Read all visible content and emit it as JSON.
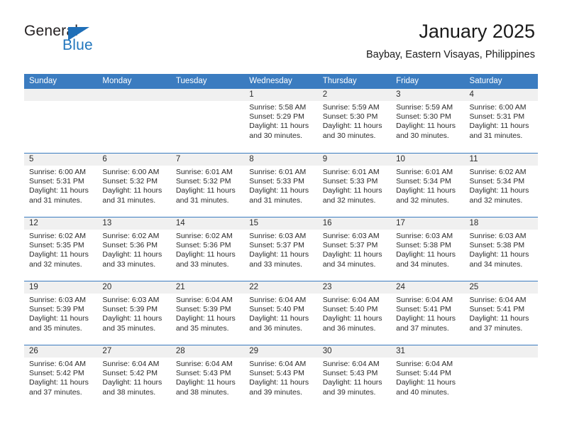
{
  "brand": {
    "word_general": "General",
    "word_blue": "Blue",
    "logo_icon": "triangle-icon"
  },
  "header": {
    "title": "January 2025",
    "subtitle": "Baybay, Eastern Visayas, Philippines"
  },
  "colors": {
    "header_blue": "#3b7cc0",
    "brand_blue": "#2176bd",
    "daybar_gray": "#f0f0f0",
    "text": "#2b2b2b"
  },
  "weekdays": [
    "Sunday",
    "Monday",
    "Tuesday",
    "Wednesday",
    "Thursday",
    "Friday",
    "Saturday"
  ],
  "weeks": [
    [
      {
        "day": "",
        "sunrise": "",
        "sunset": "",
        "daylight1": "",
        "daylight2": ""
      },
      {
        "day": "",
        "sunrise": "",
        "sunset": "",
        "daylight1": "",
        "daylight2": ""
      },
      {
        "day": "",
        "sunrise": "",
        "sunset": "",
        "daylight1": "",
        "daylight2": ""
      },
      {
        "day": "1",
        "sunrise": "Sunrise: 5:58 AM",
        "sunset": "Sunset: 5:29 PM",
        "daylight1": "Daylight: 11 hours",
        "daylight2": "and 30 minutes."
      },
      {
        "day": "2",
        "sunrise": "Sunrise: 5:59 AM",
        "sunset": "Sunset: 5:30 PM",
        "daylight1": "Daylight: 11 hours",
        "daylight2": "and 30 minutes."
      },
      {
        "day": "3",
        "sunrise": "Sunrise: 5:59 AM",
        "sunset": "Sunset: 5:30 PM",
        "daylight1": "Daylight: 11 hours",
        "daylight2": "and 30 minutes."
      },
      {
        "day": "4",
        "sunrise": "Sunrise: 6:00 AM",
        "sunset": "Sunset: 5:31 PM",
        "daylight1": "Daylight: 11 hours",
        "daylight2": "and 31 minutes."
      }
    ],
    [
      {
        "day": "5",
        "sunrise": "Sunrise: 6:00 AM",
        "sunset": "Sunset: 5:31 PM",
        "daylight1": "Daylight: 11 hours",
        "daylight2": "and 31 minutes."
      },
      {
        "day": "6",
        "sunrise": "Sunrise: 6:00 AM",
        "sunset": "Sunset: 5:32 PM",
        "daylight1": "Daylight: 11 hours",
        "daylight2": "and 31 minutes."
      },
      {
        "day": "7",
        "sunrise": "Sunrise: 6:01 AM",
        "sunset": "Sunset: 5:32 PM",
        "daylight1": "Daylight: 11 hours",
        "daylight2": "and 31 minutes."
      },
      {
        "day": "8",
        "sunrise": "Sunrise: 6:01 AM",
        "sunset": "Sunset: 5:33 PM",
        "daylight1": "Daylight: 11 hours",
        "daylight2": "and 31 minutes."
      },
      {
        "day": "9",
        "sunrise": "Sunrise: 6:01 AM",
        "sunset": "Sunset: 5:33 PM",
        "daylight1": "Daylight: 11 hours",
        "daylight2": "and 32 minutes."
      },
      {
        "day": "10",
        "sunrise": "Sunrise: 6:01 AM",
        "sunset": "Sunset: 5:34 PM",
        "daylight1": "Daylight: 11 hours",
        "daylight2": "and 32 minutes."
      },
      {
        "day": "11",
        "sunrise": "Sunrise: 6:02 AM",
        "sunset": "Sunset: 5:34 PM",
        "daylight1": "Daylight: 11 hours",
        "daylight2": "and 32 minutes."
      }
    ],
    [
      {
        "day": "12",
        "sunrise": "Sunrise: 6:02 AM",
        "sunset": "Sunset: 5:35 PM",
        "daylight1": "Daylight: 11 hours",
        "daylight2": "and 32 minutes."
      },
      {
        "day": "13",
        "sunrise": "Sunrise: 6:02 AM",
        "sunset": "Sunset: 5:36 PM",
        "daylight1": "Daylight: 11 hours",
        "daylight2": "and 33 minutes."
      },
      {
        "day": "14",
        "sunrise": "Sunrise: 6:02 AM",
        "sunset": "Sunset: 5:36 PM",
        "daylight1": "Daylight: 11 hours",
        "daylight2": "and 33 minutes."
      },
      {
        "day": "15",
        "sunrise": "Sunrise: 6:03 AM",
        "sunset": "Sunset: 5:37 PM",
        "daylight1": "Daylight: 11 hours",
        "daylight2": "and 33 minutes."
      },
      {
        "day": "16",
        "sunrise": "Sunrise: 6:03 AM",
        "sunset": "Sunset: 5:37 PM",
        "daylight1": "Daylight: 11 hours",
        "daylight2": "and 34 minutes."
      },
      {
        "day": "17",
        "sunrise": "Sunrise: 6:03 AM",
        "sunset": "Sunset: 5:38 PM",
        "daylight1": "Daylight: 11 hours",
        "daylight2": "and 34 minutes."
      },
      {
        "day": "18",
        "sunrise": "Sunrise: 6:03 AM",
        "sunset": "Sunset: 5:38 PM",
        "daylight1": "Daylight: 11 hours",
        "daylight2": "and 34 minutes."
      }
    ],
    [
      {
        "day": "19",
        "sunrise": "Sunrise: 6:03 AM",
        "sunset": "Sunset: 5:39 PM",
        "daylight1": "Daylight: 11 hours",
        "daylight2": "and 35 minutes."
      },
      {
        "day": "20",
        "sunrise": "Sunrise: 6:03 AM",
        "sunset": "Sunset: 5:39 PM",
        "daylight1": "Daylight: 11 hours",
        "daylight2": "and 35 minutes."
      },
      {
        "day": "21",
        "sunrise": "Sunrise: 6:04 AM",
        "sunset": "Sunset: 5:39 PM",
        "daylight1": "Daylight: 11 hours",
        "daylight2": "and 35 minutes."
      },
      {
        "day": "22",
        "sunrise": "Sunrise: 6:04 AM",
        "sunset": "Sunset: 5:40 PM",
        "daylight1": "Daylight: 11 hours",
        "daylight2": "and 36 minutes."
      },
      {
        "day": "23",
        "sunrise": "Sunrise: 6:04 AM",
        "sunset": "Sunset: 5:40 PM",
        "daylight1": "Daylight: 11 hours",
        "daylight2": "and 36 minutes."
      },
      {
        "day": "24",
        "sunrise": "Sunrise: 6:04 AM",
        "sunset": "Sunset: 5:41 PM",
        "daylight1": "Daylight: 11 hours",
        "daylight2": "and 37 minutes."
      },
      {
        "day": "25",
        "sunrise": "Sunrise: 6:04 AM",
        "sunset": "Sunset: 5:41 PM",
        "daylight1": "Daylight: 11 hours",
        "daylight2": "and 37 minutes."
      }
    ],
    [
      {
        "day": "26",
        "sunrise": "Sunrise: 6:04 AM",
        "sunset": "Sunset: 5:42 PM",
        "daylight1": "Daylight: 11 hours",
        "daylight2": "and 37 minutes."
      },
      {
        "day": "27",
        "sunrise": "Sunrise: 6:04 AM",
        "sunset": "Sunset: 5:42 PM",
        "daylight1": "Daylight: 11 hours",
        "daylight2": "and 38 minutes."
      },
      {
        "day": "28",
        "sunrise": "Sunrise: 6:04 AM",
        "sunset": "Sunset: 5:43 PM",
        "daylight1": "Daylight: 11 hours",
        "daylight2": "and 38 minutes."
      },
      {
        "day": "29",
        "sunrise": "Sunrise: 6:04 AM",
        "sunset": "Sunset: 5:43 PM",
        "daylight1": "Daylight: 11 hours",
        "daylight2": "and 39 minutes."
      },
      {
        "day": "30",
        "sunrise": "Sunrise: 6:04 AM",
        "sunset": "Sunset: 5:43 PM",
        "daylight1": "Daylight: 11 hours",
        "daylight2": "and 39 minutes."
      },
      {
        "day": "31",
        "sunrise": "Sunrise: 6:04 AM",
        "sunset": "Sunset: 5:44 PM",
        "daylight1": "Daylight: 11 hours",
        "daylight2": "and 40 minutes."
      },
      {
        "day": "",
        "sunrise": "",
        "sunset": "",
        "daylight1": "",
        "daylight2": ""
      }
    ]
  ]
}
